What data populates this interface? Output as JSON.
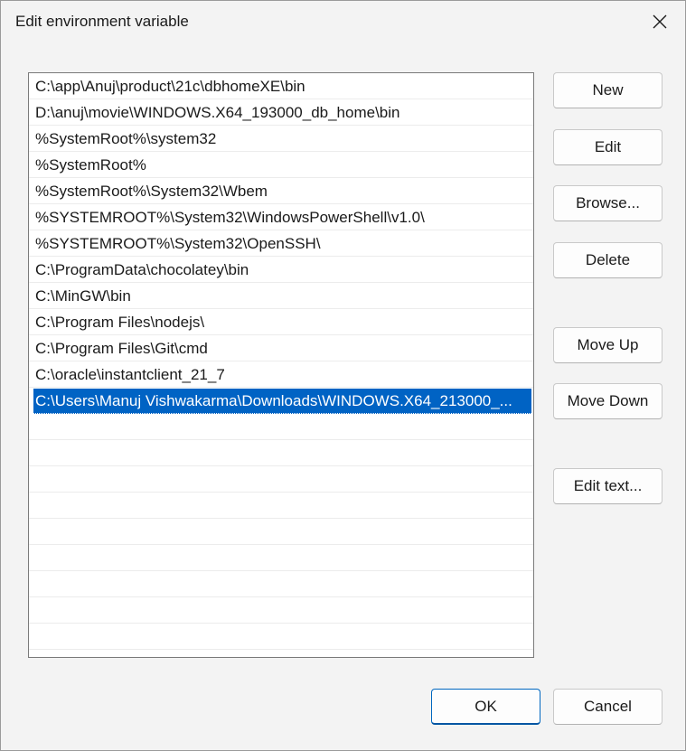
{
  "window": {
    "title": "Edit environment variable"
  },
  "list": {
    "items": [
      "C:\\app\\Anuj\\product\\21c\\dbhomeXE\\bin",
      "D:\\anuj\\movie\\WINDOWS.X64_193000_db_home\\bin",
      "%SystemRoot%\\system32",
      "%SystemRoot%",
      "%SystemRoot%\\System32\\Wbem",
      "%SYSTEMROOT%\\System32\\WindowsPowerShell\\v1.0\\",
      "%SYSTEMROOT%\\System32\\OpenSSH\\",
      "C:\\ProgramData\\chocolatey\\bin",
      "C:\\MinGW\\bin",
      "C:\\Program Files\\nodejs\\",
      "C:\\Program Files\\Git\\cmd",
      "C:\\oracle\\instantclient_21_7",
      "C:\\Users\\Manuj Vishwakarma\\Downloads\\WINDOWS.X64_213000_..."
    ],
    "selected_index": 12
  },
  "buttons": {
    "new": "New",
    "edit": "Edit",
    "browse": "Browse...",
    "delete": "Delete",
    "move_up": "Move Up",
    "move_down": "Move Down",
    "edit_text": "Edit text...",
    "ok": "OK",
    "cancel": "Cancel"
  },
  "icons": {
    "close": "close-icon"
  },
  "colors": {
    "selection": "#0063c4",
    "accent": "#0067c0"
  }
}
